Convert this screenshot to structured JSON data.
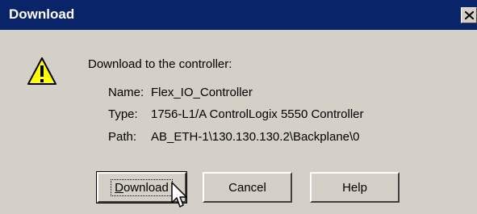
{
  "window": {
    "title": "Download"
  },
  "message": {
    "heading": "Download to the controller:",
    "name_label": "Name:",
    "name_value": "Flex_IO_Controller",
    "type_label": "Type:",
    "type_value": "1756-L1/A ControlLogix 5550 Controller",
    "path_label": "Path:",
    "path_value": "AB_ETH-1\\130.130.130.2\\Backplane\\0"
  },
  "buttons": {
    "download_mnemonic": "D",
    "download_rest": "ownload",
    "cancel": "Cancel",
    "help": "Help"
  },
  "icons": {
    "warning": "warning-icon",
    "close": "close-icon",
    "cursor": "mouse-pointer-icon"
  },
  "colors": {
    "titlebar": "#0a246a",
    "dialog_bg": "#d4d0c8",
    "warning_fill": "#ffff00"
  }
}
